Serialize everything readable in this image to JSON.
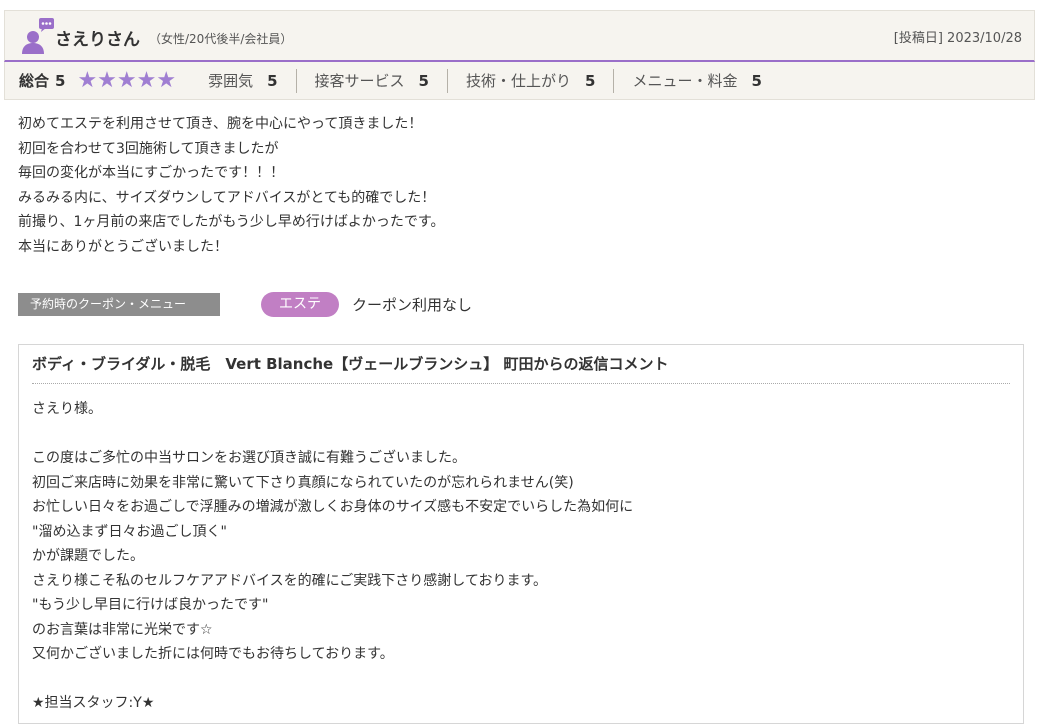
{
  "reviewer": {
    "name": "さえりさん",
    "profile": "（女性/20代後半/会社員）",
    "post_date": "[投稿日] 2023/10/28"
  },
  "ratings": {
    "overall_label": "総合",
    "overall_score": "5",
    "stars": "★★★★★",
    "star_count": 5,
    "star_color": "#a07fd2",
    "categories": [
      {
        "label": "雰囲気",
        "score": "5"
      },
      {
        "label": "接客サービス",
        "score": "5"
      },
      {
        "label": "技術・仕上がり",
        "score": "5"
      },
      {
        "label": "メニュー・料金",
        "score": "5"
      }
    ]
  },
  "review": {
    "lines": [
      "初めてエステを利用させて頂き、腕を中心にやって頂きました！",
      "初回を合わせて3回施術して頂きましたが",
      "毎回の変化が本当にすごかったです！！！",
      "みるみる内に、サイズダウンしてアドバイスがとても的確でした！",
      "前撮り、1ヶ月前の来店でしたがもう少し早め行けばよかったです。",
      "本当にありがとうございました！"
    ]
  },
  "coupon": {
    "label": "予約時のクーポン・メニュー",
    "tag": "エステ",
    "tag_color": "#c17fc4",
    "text": "クーポン利用なし"
  },
  "reply": {
    "title": "ボディ・ブライダル・脱毛　Vert Blanche【ヴェールブランシュ】 町田からの返信コメント",
    "lines": [
      "さえり様。",
      "",
      "この度はご多忙の中当サロンをお選び頂き誠に有難うございました。",
      "初回ご来店時に効果を非常に驚いて下さり真顔になられていたのが忘れられません(笑)",
      "お忙しい日々をお過ごしで浮腫みの増減が激しくお身体のサイズ感も不安定でいらした為如何に",
      "\"溜め込まず日々お過ごし頂く\"",
      "かが課題でした。",
      "さえり様こそ私のセルフケアアドバイスを的確にご実践下さり感謝しております。",
      "\"もう少し早目に行けば良かったです\"",
      "のお言葉は非常に光栄です☆",
      "又何かございました折には何時でもお待ちしております。",
      "",
      "★担当スタッフ:Y★"
    ]
  },
  "colors": {
    "accent_purple": "#9a6fc9",
    "header_bg": "#f6f4ef",
    "coupon_label_bg": "#8d8d8d"
  }
}
